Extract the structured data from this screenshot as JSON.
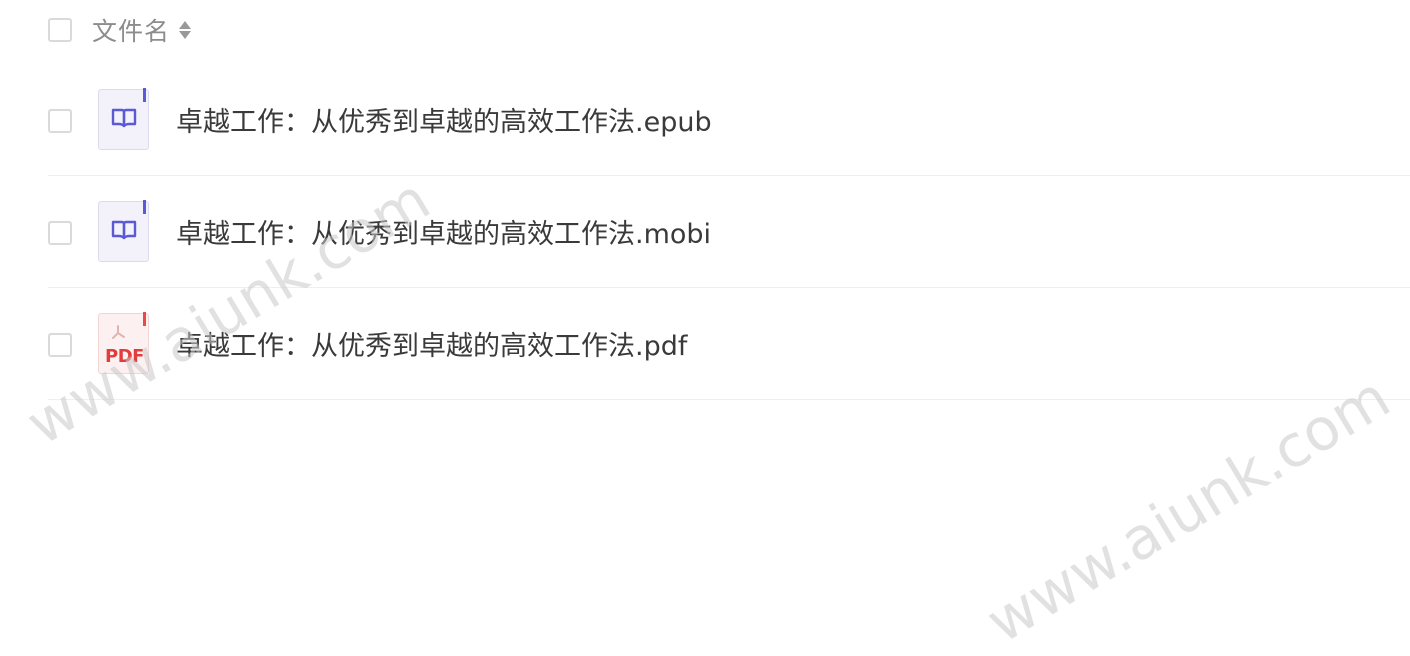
{
  "header": {
    "column_label": "文件名",
    "sort_icon": "sort-both-icon"
  },
  "files": [
    {
      "name": "卓越工作：从优秀到卓越的高效工作法.epub",
      "type": "epub",
      "icon": "book-icon"
    },
    {
      "name": "卓越工作：从优秀到卓越的高效工作法.mobi",
      "type": "mobi",
      "icon": "book-icon"
    },
    {
      "name": "卓越工作：从优秀到卓越的高效工作法.pdf",
      "type": "pdf",
      "icon": "pdf-icon",
      "icon_text": "PDF"
    }
  ],
  "watermark": "www.aiunk.com",
  "colors": {
    "book_accent": "#5b59d6",
    "pdf_accent": "#e23d3d"
  }
}
